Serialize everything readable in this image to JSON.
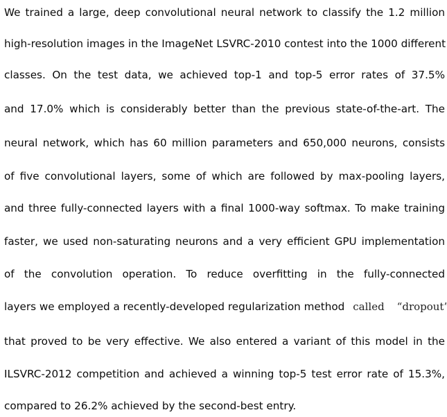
{
  "paragraph": {
    "lines": [
      "We trained a large, deep convolutional neural network to classify the 1.2 million",
      "high-resolution images in the ImageNet LSVRC-2010 contest into the 1000 different",
      "classes. On the test data, we achieved top-1 and top-5 error rates of 37.5%",
      "and 17.0% which is considerably better than the previous state-of-the-art. The",
      "neural network, which has 60 million parameters and 650,000 neurons, consists",
      "of five convolutional layers, some of which are followed by max-pooling layers,",
      "and three fully-connected layers with a final 1000-way softmax. To make training",
      "faster, we used non-saturating neurons and a very efficient GPU implementation",
      "of the convolution operation. To reduce overfitting in the fully-connected"
    ],
    "line10_main": "layers we employed a recently-developed regularization method",
    "line10_called": "called",
    "line10_dropout": "“dropout”",
    "lines_after": [
      "that proved to be very effective. We also entered a variant of this model in the",
      "ILSVRC-2012 competition and achieved a winning top-5 test error rate of 15.3%,",
      "compared to 26.2% achieved by the second-best entry."
    ]
  }
}
